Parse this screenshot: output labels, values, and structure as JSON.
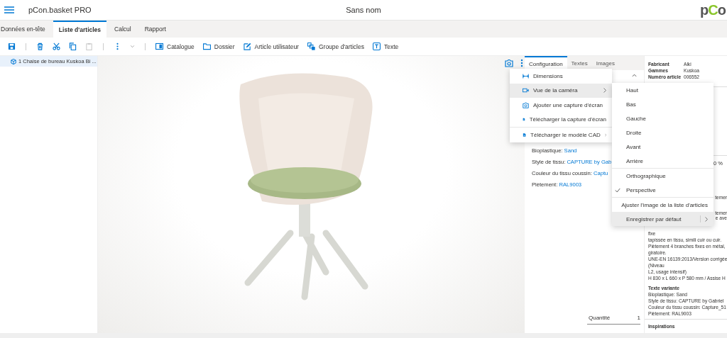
{
  "header": {
    "app_name": "pCon.basket PRO",
    "document_title": "Sans nom",
    "logo": [
      {
        "text": "p",
        "accent": false
      },
      {
        "text": "C",
        "accent": true
      },
      {
        "text": "o",
        "accent": false
      }
    ]
  },
  "tabs": [
    {
      "label": "Données en-tête",
      "selected": false
    },
    {
      "label": "Liste d'articles",
      "selected": true
    },
    {
      "label": "Calcul",
      "selected": false
    },
    {
      "label": "Rapport",
      "selected": false
    }
  ],
  "toolbar": {
    "icon_buttons": [
      {
        "disabled": false
      },
      {
        "disabled": false
      },
      {
        "disabled": false
      },
      {
        "disabled": false
      },
      {
        "disabled": true
      },
      {
        "disabled": false
      },
      {
        "disabled": false
      }
    ],
    "buttons": [
      "Catalogue",
      "Dossier",
      "Article utilisateur",
      "Groupe d'articles",
      "Texte"
    ]
  },
  "article_list": [
    {
      "label": "1 Chaise de bureau Kuskoa Bi ...",
      "selected": true
    }
  ],
  "config_panel": {
    "tabs": [
      {
        "label": "Configuration",
        "selected": true
      },
      {
        "label": "Textes",
        "selected": false
      },
      {
        "label": "Images",
        "selected": false
      }
    ],
    "properties": [
      {
        "name": "Bioplastique:",
        "value": "Sand"
      },
      {
        "name": "Style de tissu:",
        "value": "CAPTURE by Gab"
      },
      {
        "name": "Couleur du tissu coussin:",
        "value": "Captu"
      },
      {
        "name": "Piètement:",
        "value": "RAL9003"
      }
    ],
    "quantity": {
      "label": "Quantité",
      "value": "1"
    }
  },
  "viewport_menu": {
    "groups": [
      [
        {
          "label": "Dimensions",
          "highlighted": false,
          "submenu": false
        },
        {
          "label": "Vue de la caméra",
          "highlighted": true,
          "submenu": true
        },
        {
          "label": "Ajouter une capture d'écran",
          "highlighted": false,
          "submenu": false
        },
        {
          "label": "Télécharger la capture d'écran",
          "highlighted": false,
          "submenu": false
        }
      ],
      [
        {
          "label": "Télécharger le modèle CAD",
          "highlighted": false,
          "submenu": true
        }
      ]
    ]
  },
  "camera_submenu": {
    "groups": [
      [
        {
          "label": "Haut",
          "checked": false,
          "highlighted": false,
          "submenu": false
        },
        {
          "label": "Bas",
          "checked": false,
          "highlighted": false,
          "submenu": false
        },
        {
          "label": "Gauche",
          "checked": false,
          "highlighted": false,
          "submenu": false
        },
        {
          "label": "Droite",
          "checked": false,
          "highlighted": false,
          "submenu": false
        },
        {
          "label": "Avant",
          "checked": false,
          "highlighted": false,
          "submenu": false
        },
        {
          "label": "Arrière",
          "checked": false,
          "highlighted": false,
          "submenu": false
        }
      ],
      [
        {
          "label": "Orthographique",
          "checked": false,
          "highlighted": false,
          "submenu": false
        },
        {
          "label": "Perspective",
          "checked": true,
          "highlighted": false,
          "submenu": false
        }
      ],
      [
        {
          "label": "Ajuster l'image de la liste d'articles",
          "checked": false,
          "highlighted": false,
          "submenu": false
        },
        {
          "label": "Enregistrer par défaut",
          "checked": false,
          "highlighted": true,
          "submenu": true
        }
      ]
    ]
  },
  "info_panel": {
    "fields": [
      {
        "label": "Fabricant",
        "value": "Alki"
      },
      {
        "label": "Gammes",
        "value": "Kuskoa"
      },
      {
        "label": "Numéro article",
        "value": "006552"
      }
    ],
    "discount": "0 %",
    "fragments": [
      "temer",
      "temer",
      "e ave"
    ],
    "description": [
      "fixe",
      "tapissée en tissu, simili cuir ou cuir.",
      "Piètement 4 branches fixes en métal,",
      "giratoire.",
      "UNE-EN 16139:2013/Version corrigée",
      "(Niveau",
      "L2, usage intensif)",
      "H 830 x L 660 x P 580 mm / Assise H"
    ],
    "variant_title": "Texte variante",
    "variant_lines": [
      "Bioplastique: Sand",
      "Style de tissu: CAPTURE by Gabriel",
      "Couleur du tissu coussin: Capture_51",
      "Piètement: RAL9003"
    ],
    "inspirations": "Inspirations"
  }
}
